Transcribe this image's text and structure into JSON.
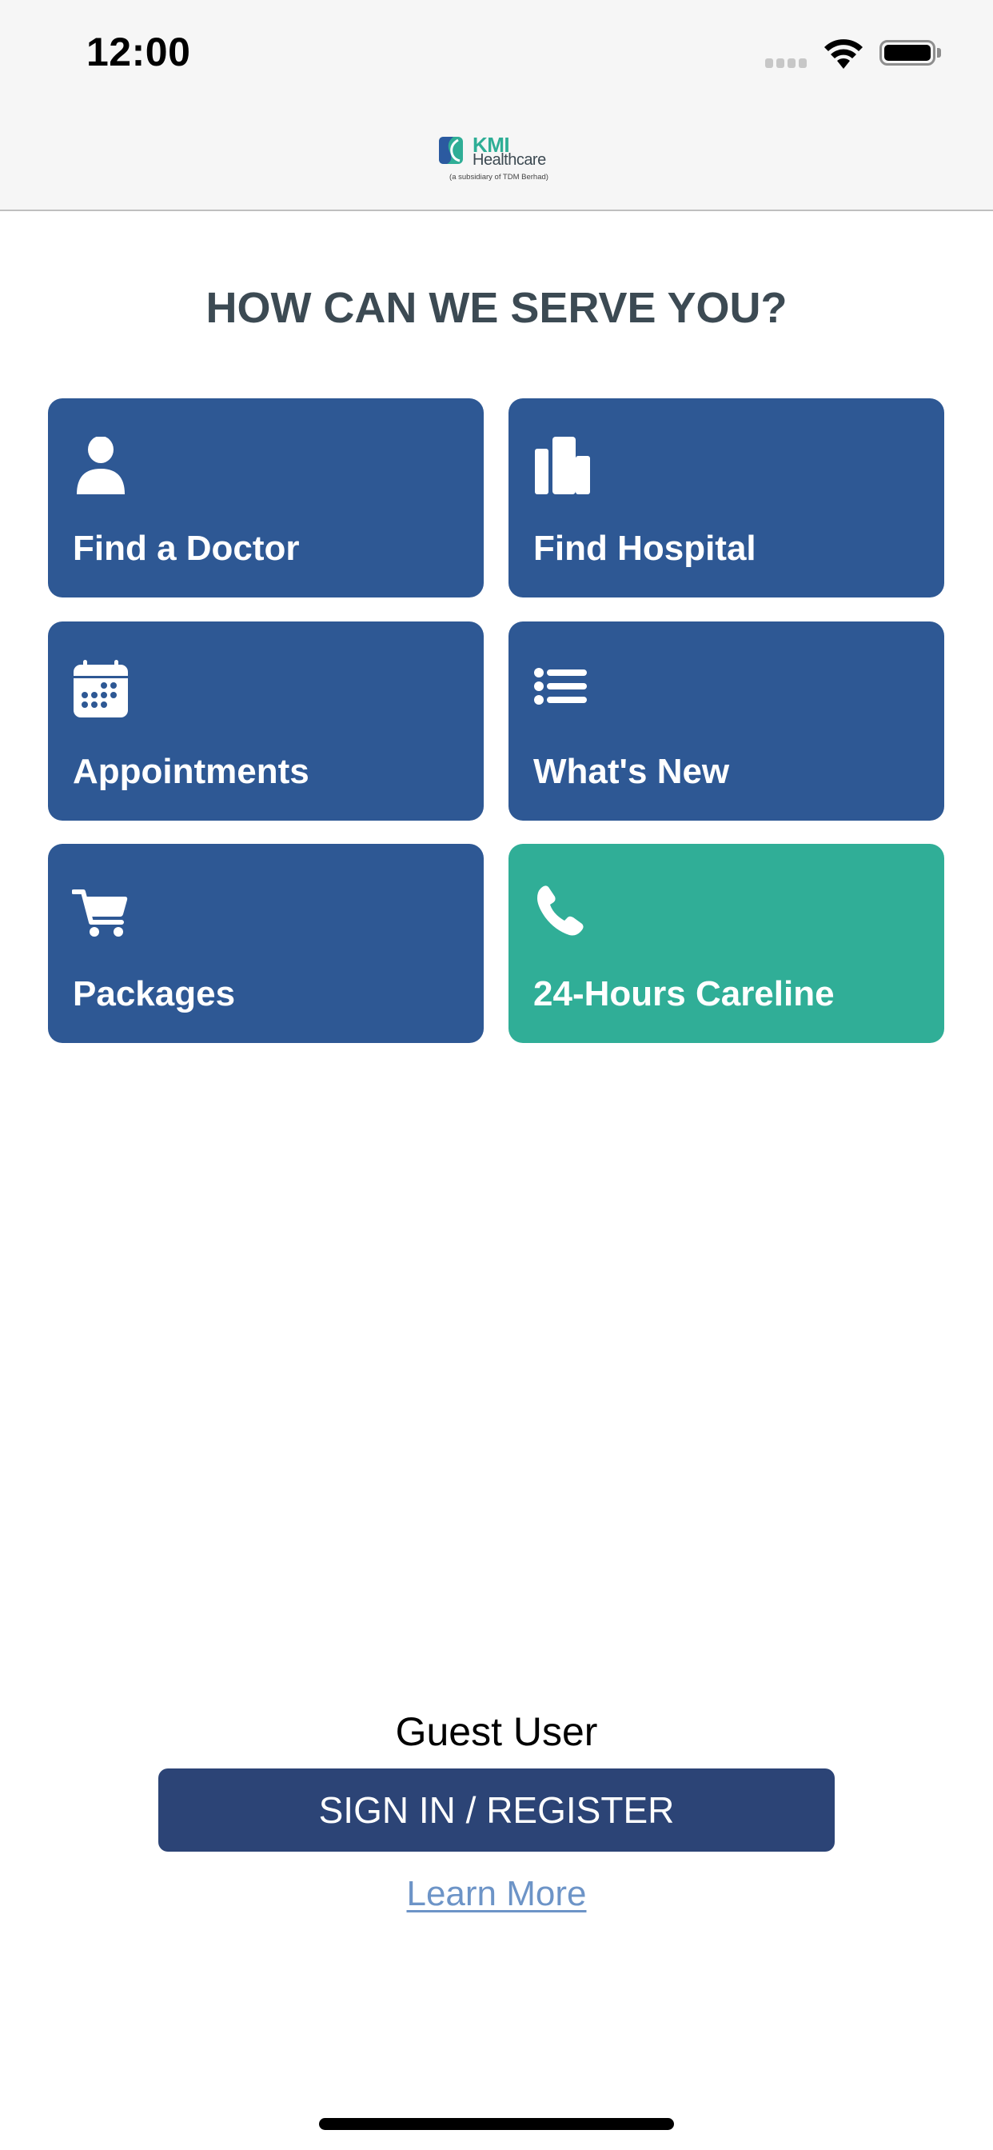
{
  "status_bar": {
    "time": "12:00",
    "signal_icon": "cellular-signal-icon",
    "wifi_icon": "wifi-icon",
    "battery_icon": "battery-full-icon"
  },
  "header": {
    "logo": {
      "brand": "KMI",
      "name": "Healthcare",
      "subtitle": "(a subsidiary of TDM Berhad)"
    }
  },
  "main": {
    "title": "HOW CAN WE SERVE YOU?",
    "tiles": [
      {
        "label": "Find a Doctor",
        "icon": "person-icon",
        "color": "#2e5894"
      },
      {
        "label": "Find Hospital",
        "icon": "building-icon",
        "color": "#2e5894"
      },
      {
        "label": "Appointments",
        "icon": "calendar-icon",
        "color": "#2e5894"
      },
      {
        "label": "What's New",
        "icon": "list-icon",
        "color": "#2e5894"
      },
      {
        "label": "Packages",
        "icon": "cart-icon",
        "color": "#2e5894"
      },
      {
        "label": "24-Hours Careline",
        "icon": "phone-icon",
        "color": "#30ae97"
      }
    ]
  },
  "footer": {
    "user_label": "Guest User",
    "signin_button": "SIGN IN / REGISTER",
    "learn_more_link": "Learn More"
  },
  "colors": {
    "tile_primary": "#2e5894",
    "tile_accent": "#30ae97",
    "signin_button": "#2c4476",
    "link": "#6d94c7",
    "title_text": "#3c4a53"
  }
}
